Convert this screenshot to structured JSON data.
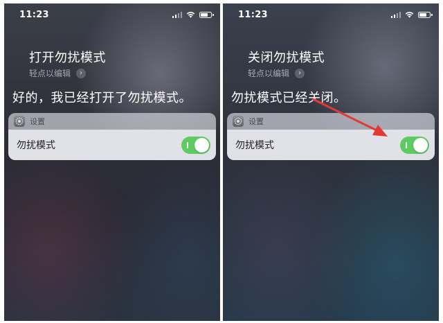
{
  "status": {
    "time": "11:23"
  },
  "left": {
    "query": "打开勿扰模式",
    "edit_hint": "轻点以编辑",
    "reply": "好的，我已经打开了勿扰模式。",
    "card_title": "设置",
    "card_label": "勿扰模式",
    "toggle_on": true
  },
  "right": {
    "query": "关闭勿扰模式",
    "edit_hint": "轻点以编辑",
    "reply": "勿扰模式已经关闭。",
    "card_title": "设置",
    "card_label": "勿扰模式",
    "toggle_on": true
  },
  "colors": {
    "toggle": "#5ecb62",
    "arrow": "#e53935"
  },
  "icons": [
    "wifi-icon",
    "battery-icon",
    "signal-icon",
    "chevron-right-icon",
    "settings-gear-icon",
    "red-arrow-icon"
  ]
}
